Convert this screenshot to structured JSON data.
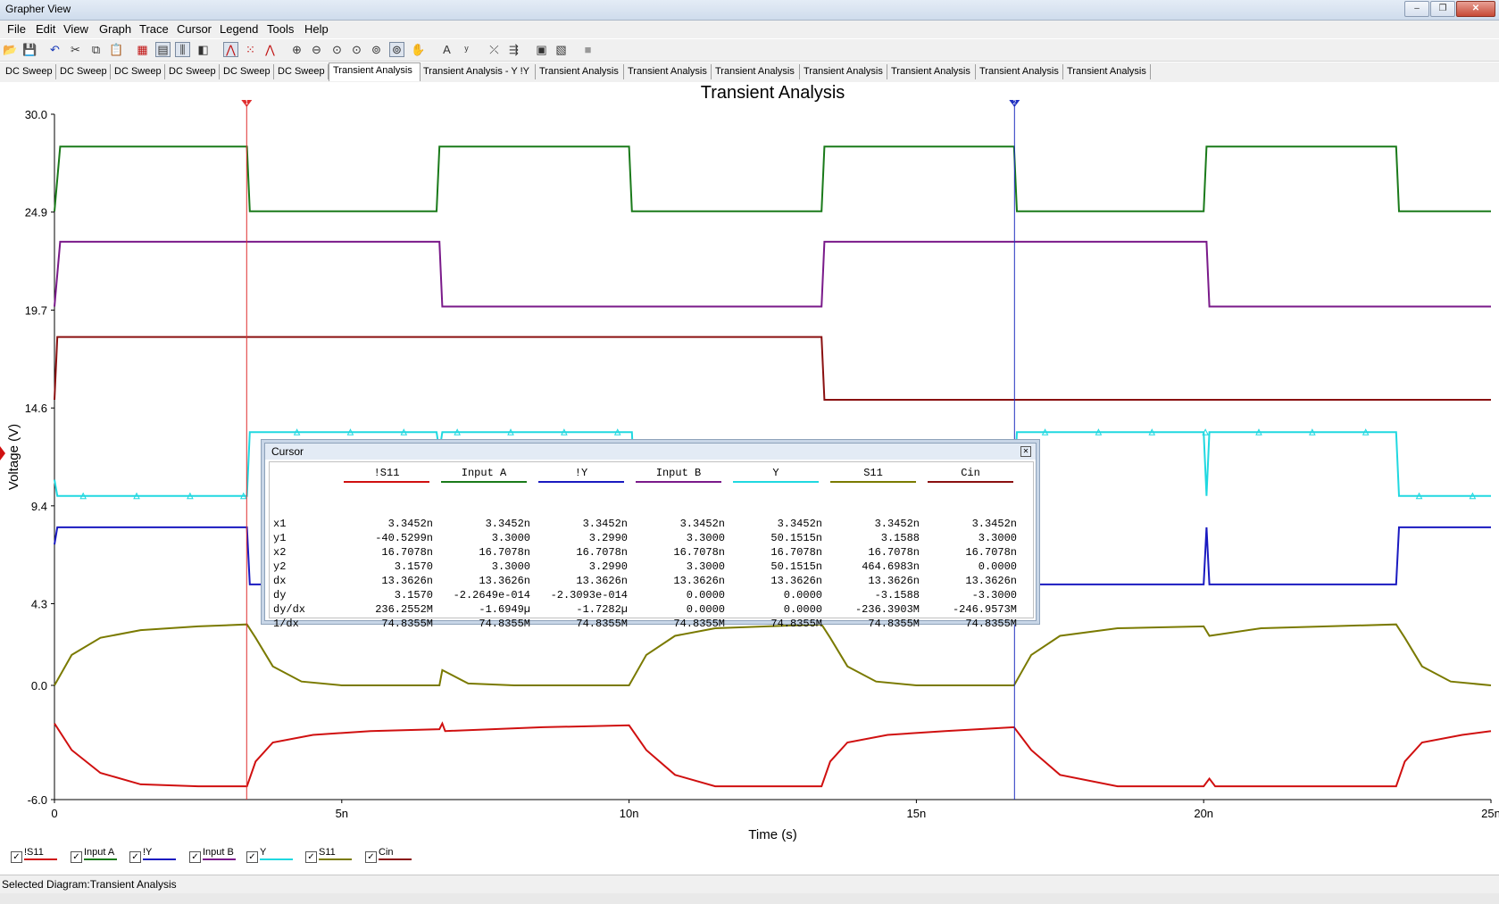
{
  "window": {
    "title": "Grapher View"
  },
  "menu": [
    "File",
    "Edit",
    "View",
    "Graph",
    "Trace",
    "Cursor",
    "Legend",
    "Tools",
    "Help"
  ],
  "toolbar_icons": [
    "open-icon",
    "save-icon",
    "undo-icon",
    "cut-icon",
    "copy-icon",
    "paste-icon",
    "grid-icon",
    "legend-icon",
    "cursor-toggle-icon",
    "overlay-icon",
    "line-icon",
    "dots-icon",
    "markers-icon",
    "zoom-in-icon",
    "zoom-out-icon",
    "zoom-x-icon",
    "zoom-y-icon",
    "zoom-fit-icon",
    "zoom-area-icon",
    "pan-icon",
    "text-icon",
    "label-icon",
    "trace-icon",
    "export-icon",
    "copy-graph-icon",
    "properties-icon",
    "stop-icon"
  ],
  "tabs": [
    "DC Sweep",
    "DC Sweep",
    "DC Sweep",
    "DC Sweep",
    "DC Sweep",
    "DC Sweep",
    "Transient Analysis",
    "Transient Analysis - Y  !Y",
    "Transient Analysis",
    "Transient Analysis",
    "Transient Analysis",
    "Transient Analysis",
    "Transient Analysis",
    "Transient Analysis",
    "Transient Analysis"
  ],
  "active_tab": 6,
  "chart_data": {
    "type": "line",
    "title": "Transient Analysis",
    "xlabel": "Time (s)",
    "ylabel": "Voltage (V)",
    "xlim": [
      0,
      25
    ],
    "ylim": [
      -6.0,
      30.0
    ],
    "xticks": [
      "0",
      "5n",
      "10n",
      "15n",
      "20n",
      "25n"
    ],
    "yticks": [
      "30.0",
      "24.9",
      "19.7",
      "14.6",
      "9.4",
      "4.3",
      "0.0",
      "-6.0"
    ],
    "x_unit": "ns",
    "cursors": [
      {
        "name": "1",
        "x": 3.3452,
        "color": "#e03030"
      },
      {
        "name": "2",
        "x": 16.7078,
        "color": "#2030c0"
      }
    ],
    "series": [
      {
        "name": "Input A",
        "color": "#1a7a1a",
        "x": [
          0,
          0.1,
          3.35,
          3.4,
          6.65,
          6.7,
          10.0,
          10.05,
          13.35,
          13.4,
          16.7,
          16.75,
          20.0,
          20.05,
          23.35,
          23.4,
          25
        ],
        "y": [
          24.9,
          28.3,
          28.3,
          24.9,
          24.9,
          28.3,
          28.3,
          24.9,
          24.9,
          28.3,
          28.3,
          24.9,
          24.9,
          28.3,
          28.3,
          24.9,
          24.9
        ]
      },
      {
        "name": "Input B",
        "color": "#7a1a8a",
        "x": [
          0,
          0.1,
          6.7,
          6.75,
          13.35,
          13.4,
          20.05,
          20.1,
          25
        ],
        "y": [
          19.9,
          23.3,
          23.3,
          19.9,
          19.9,
          23.3,
          23.3,
          19.9,
          19.9
        ]
      },
      {
        "name": "Cin",
        "color": "#8a1010",
        "x": [
          0,
          0.05,
          13.35,
          13.4,
          25
        ],
        "y": [
          15.0,
          18.3,
          18.3,
          15.0,
          15.0
        ]
      },
      {
        "name": "Y",
        "color": "#20d8e0",
        "x": [
          0,
          0.05,
          3.35,
          3.4,
          6.65,
          6.7,
          6.75,
          10.05,
          10.1,
          16.7,
          16.75,
          20.0,
          20.05,
          20.1,
          23.35,
          23.4,
          25
        ],
        "y": [
          10.8,
          9.95,
          9.95,
          13.3,
          13.3,
          12.3,
          13.3,
          13.3,
          9.95,
          9.95,
          13.3,
          13.3,
          9.95,
          13.3,
          13.3,
          9.95,
          9.95
        ]
      },
      {
        "name": "!Y",
        "color": "#1a1ac0",
        "x": [
          0,
          0.05,
          3.35,
          3.4,
          10.05,
          10.1,
          16.7,
          16.75,
          20.0,
          20.05,
          20.1,
          23.35,
          23.4,
          25
        ],
        "y": [
          7.4,
          8.3,
          8.3,
          5.3,
          5.3,
          8.3,
          8.3,
          5.3,
          5.3,
          8.3,
          5.3,
          5.3,
          8.3,
          8.3
        ]
      },
      {
        "name": "S11",
        "color": "#7a7a00",
        "x": [
          0,
          0.3,
          0.8,
          1.5,
          2.5,
          3.35,
          3.5,
          3.8,
          4.3,
          5.0,
          6.7,
          6.75,
          7.2,
          8.0,
          10.0,
          10.3,
          10.8,
          11.5,
          13.35,
          13.5,
          13.8,
          14.3,
          15.0,
          16.7,
          17.0,
          17.5,
          18.5,
          20.0,
          20.1,
          21.0,
          23.35,
          23.5,
          23.8,
          24.3,
          25
        ],
        "y": [
          0.0,
          1.6,
          2.5,
          2.9,
          3.1,
          3.2,
          2.5,
          1.0,
          0.2,
          0.0,
          0.0,
          0.8,
          0.1,
          0.0,
          0.0,
          1.6,
          2.6,
          3.0,
          3.2,
          2.5,
          1.0,
          0.2,
          0.0,
          0.0,
          1.6,
          2.6,
          3.0,
          3.1,
          2.6,
          3.0,
          3.2,
          2.5,
          1.0,
          0.2,
          0.0
        ]
      },
      {
        "name": "!S11",
        "color": "#d01010",
        "x": [
          0,
          0.3,
          0.8,
          1.5,
          2.5,
          3.35,
          3.5,
          3.8,
          4.5,
          5.5,
          6.7,
          6.75,
          6.8,
          8.5,
          10.0,
          10.3,
          10.8,
          11.5,
          13.35,
          13.5,
          13.8,
          14.5,
          15.5,
          16.7,
          17.0,
          17.5,
          18.5,
          20.0,
          20.1,
          20.2,
          21.0,
          23.35,
          23.5,
          23.8,
          24.5,
          25
        ],
        "y": [
          -2.0,
          -3.4,
          -4.6,
          -5.2,
          -5.3,
          -5.3,
          -4.0,
          -3.0,
          -2.6,
          -2.4,
          -2.3,
          -2.0,
          -2.4,
          -2.2,
          -2.1,
          -3.4,
          -4.7,
          -5.3,
          -5.3,
          -4.0,
          -3.0,
          -2.6,
          -2.4,
          -2.2,
          -3.4,
          -4.7,
          -5.3,
          -5.3,
          -4.9,
          -5.3,
          -5.3,
          -5.3,
          -4.0,
          -3.0,
          -2.6,
          -2.4
        ]
      }
    ]
  },
  "cursor_window": {
    "title": "Cursor",
    "columns": [
      {
        "name": "!S11",
        "color": "#d01010"
      },
      {
        "name": "Input A",
        "color": "#1a7a1a"
      },
      {
        "name": "!Y",
        "color": "#1a1ac0"
      },
      {
        "name": "Input B",
        "color": "#7a1a8a"
      },
      {
        "name": "Y",
        "color": "#20d8e0"
      },
      {
        "name": "S11",
        "color": "#7a7a00"
      },
      {
        "name": "Cin",
        "color": "#8a1010"
      }
    ],
    "rows": [
      {
        "label": "x1",
        "values": [
          "3.3452n",
          "3.3452n",
          "3.3452n",
          "3.3452n",
          "3.3452n",
          "3.3452n",
          "3.3452n"
        ]
      },
      {
        "label": "y1",
        "values": [
          "-40.5299n",
          "3.3000",
          "3.2990",
          "3.3000",
          "50.1515n",
          "3.1588",
          "3.3000"
        ]
      },
      {
        "label": "x2",
        "values": [
          "16.7078n",
          "16.7078n",
          "16.7078n",
          "16.7078n",
          "16.7078n",
          "16.7078n",
          "16.7078n"
        ]
      },
      {
        "label": "y2",
        "values": [
          "3.1570",
          "3.3000",
          "3.2990",
          "3.3000",
          "50.1515n",
          "464.6983n",
          "0.0000"
        ]
      },
      {
        "label": "dx",
        "values": [
          "13.3626n",
          "13.3626n",
          "13.3626n",
          "13.3626n",
          "13.3626n",
          "13.3626n",
          "13.3626n"
        ]
      },
      {
        "label": "dy",
        "values": [
          "3.1570",
          "-2.2649e-014",
          "-2.3093e-014",
          "0.0000",
          "0.0000",
          "-3.1588",
          "-3.3000"
        ]
      },
      {
        "label": "dy/dx",
        "values": [
          "236.2552M",
          "-1.6949µ",
          "-1.7282µ",
          "0.0000",
          "0.0000",
          "-236.3903M",
          "-246.9573M"
        ]
      },
      {
        "label": "1/dx",
        "values": [
          "74.8355M",
          "74.8355M",
          "74.8355M",
          "74.8355M",
          "74.8355M",
          "74.8355M",
          "74.8355M"
        ]
      }
    ]
  },
  "legend": [
    {
      "name": "!S11",
      "color": "#d01010"
    },
    {
      "name": "Input A",
      "color": "#1a7a1a"
    },
    {
      "name": "!Y",
      "color": "#1a1ac0"
    },
    {
      "name": "Input B",
      "color": "#7a1a8a"
    },
    {
      "name": "Y",
      "color": "#20d8e0"
    },
    {
      "name": "S11",
      "color": "#7a7a00"
    },
    {
      "name": "Cin",
      "color": "#8a1010"
    }
  ],
  "status": {
    "text": "Selected Diagram:Transient Analysis"
  }
}
